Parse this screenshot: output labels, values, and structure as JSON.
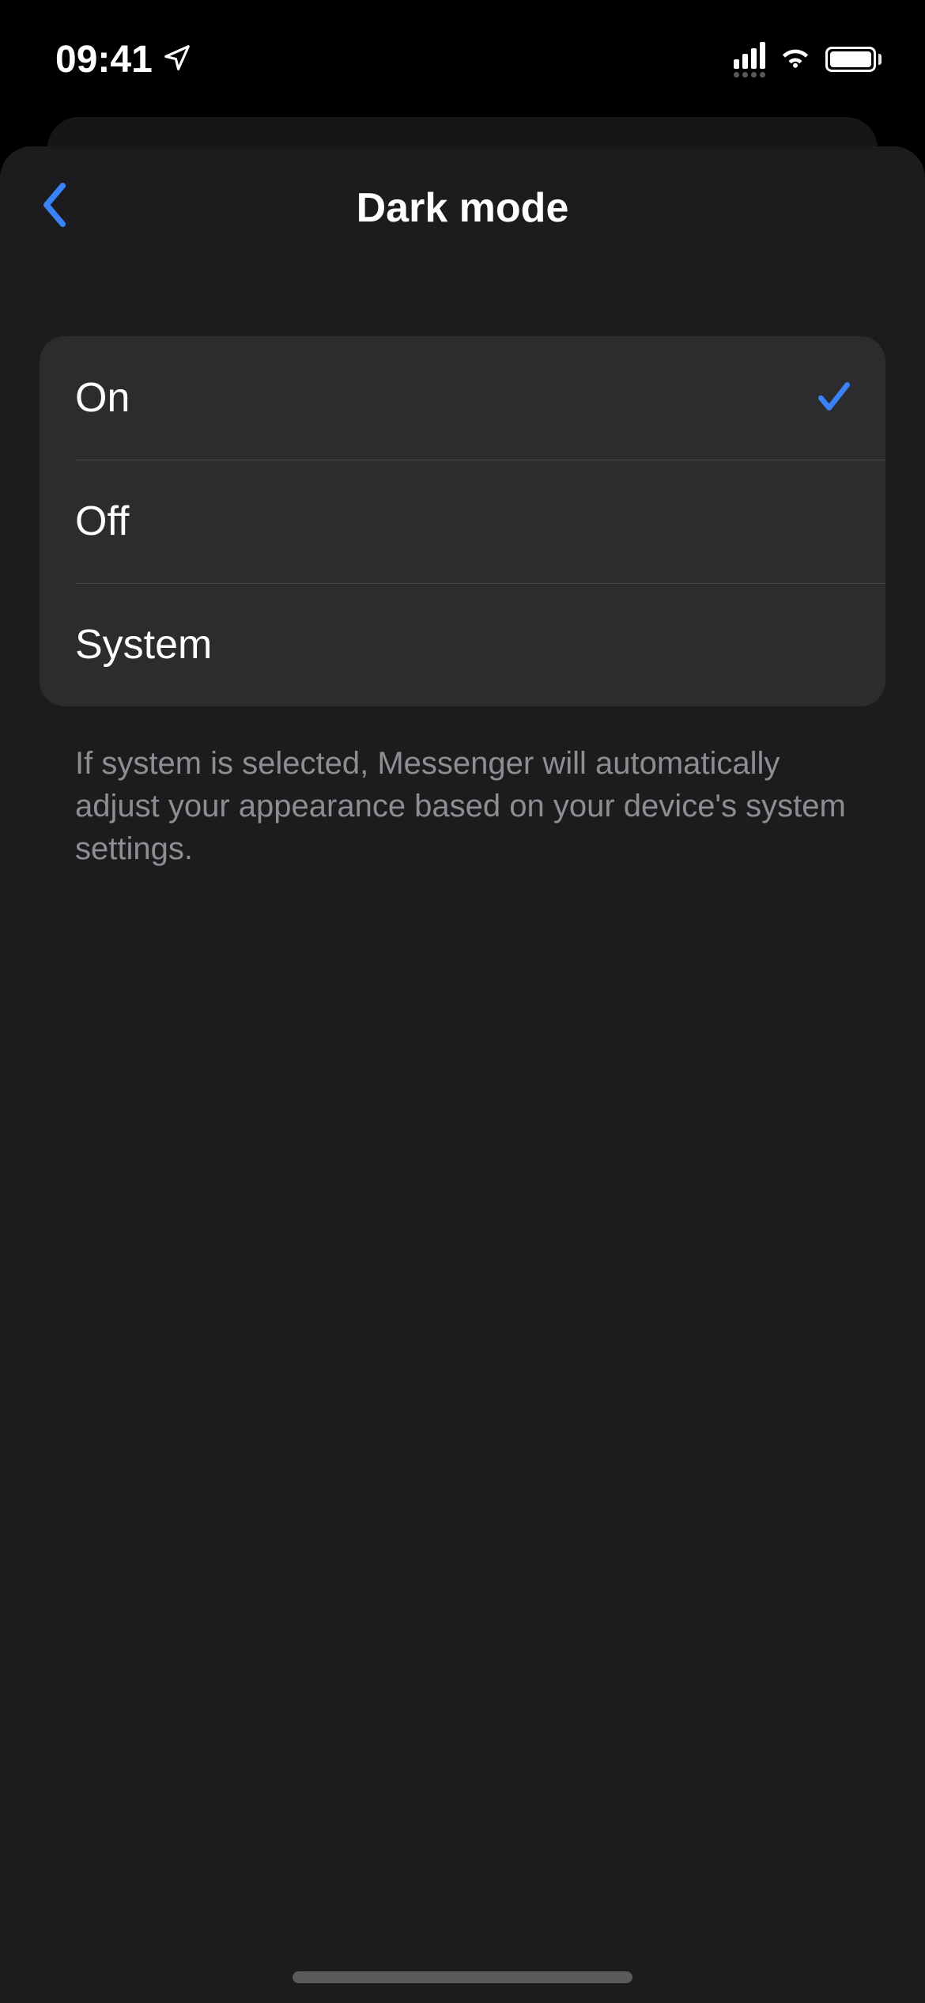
{
  "status": {
    "time": "09:41"
  },
  "nav": {
    "title": "Dark mode"
  },
  "options": [
    {
      "label": "On",
      "selected": true
    },
    {
      "label": "Off",
      "selected": false
    },
    {
      "label": "System",
      "selected": false
    }
  ],
  "footer": "If system is selected, Messenger will automatically adjust your appearance based on your device's system settings.",
  "colors": {
    "accent": "#3a82f7"
  }
}
